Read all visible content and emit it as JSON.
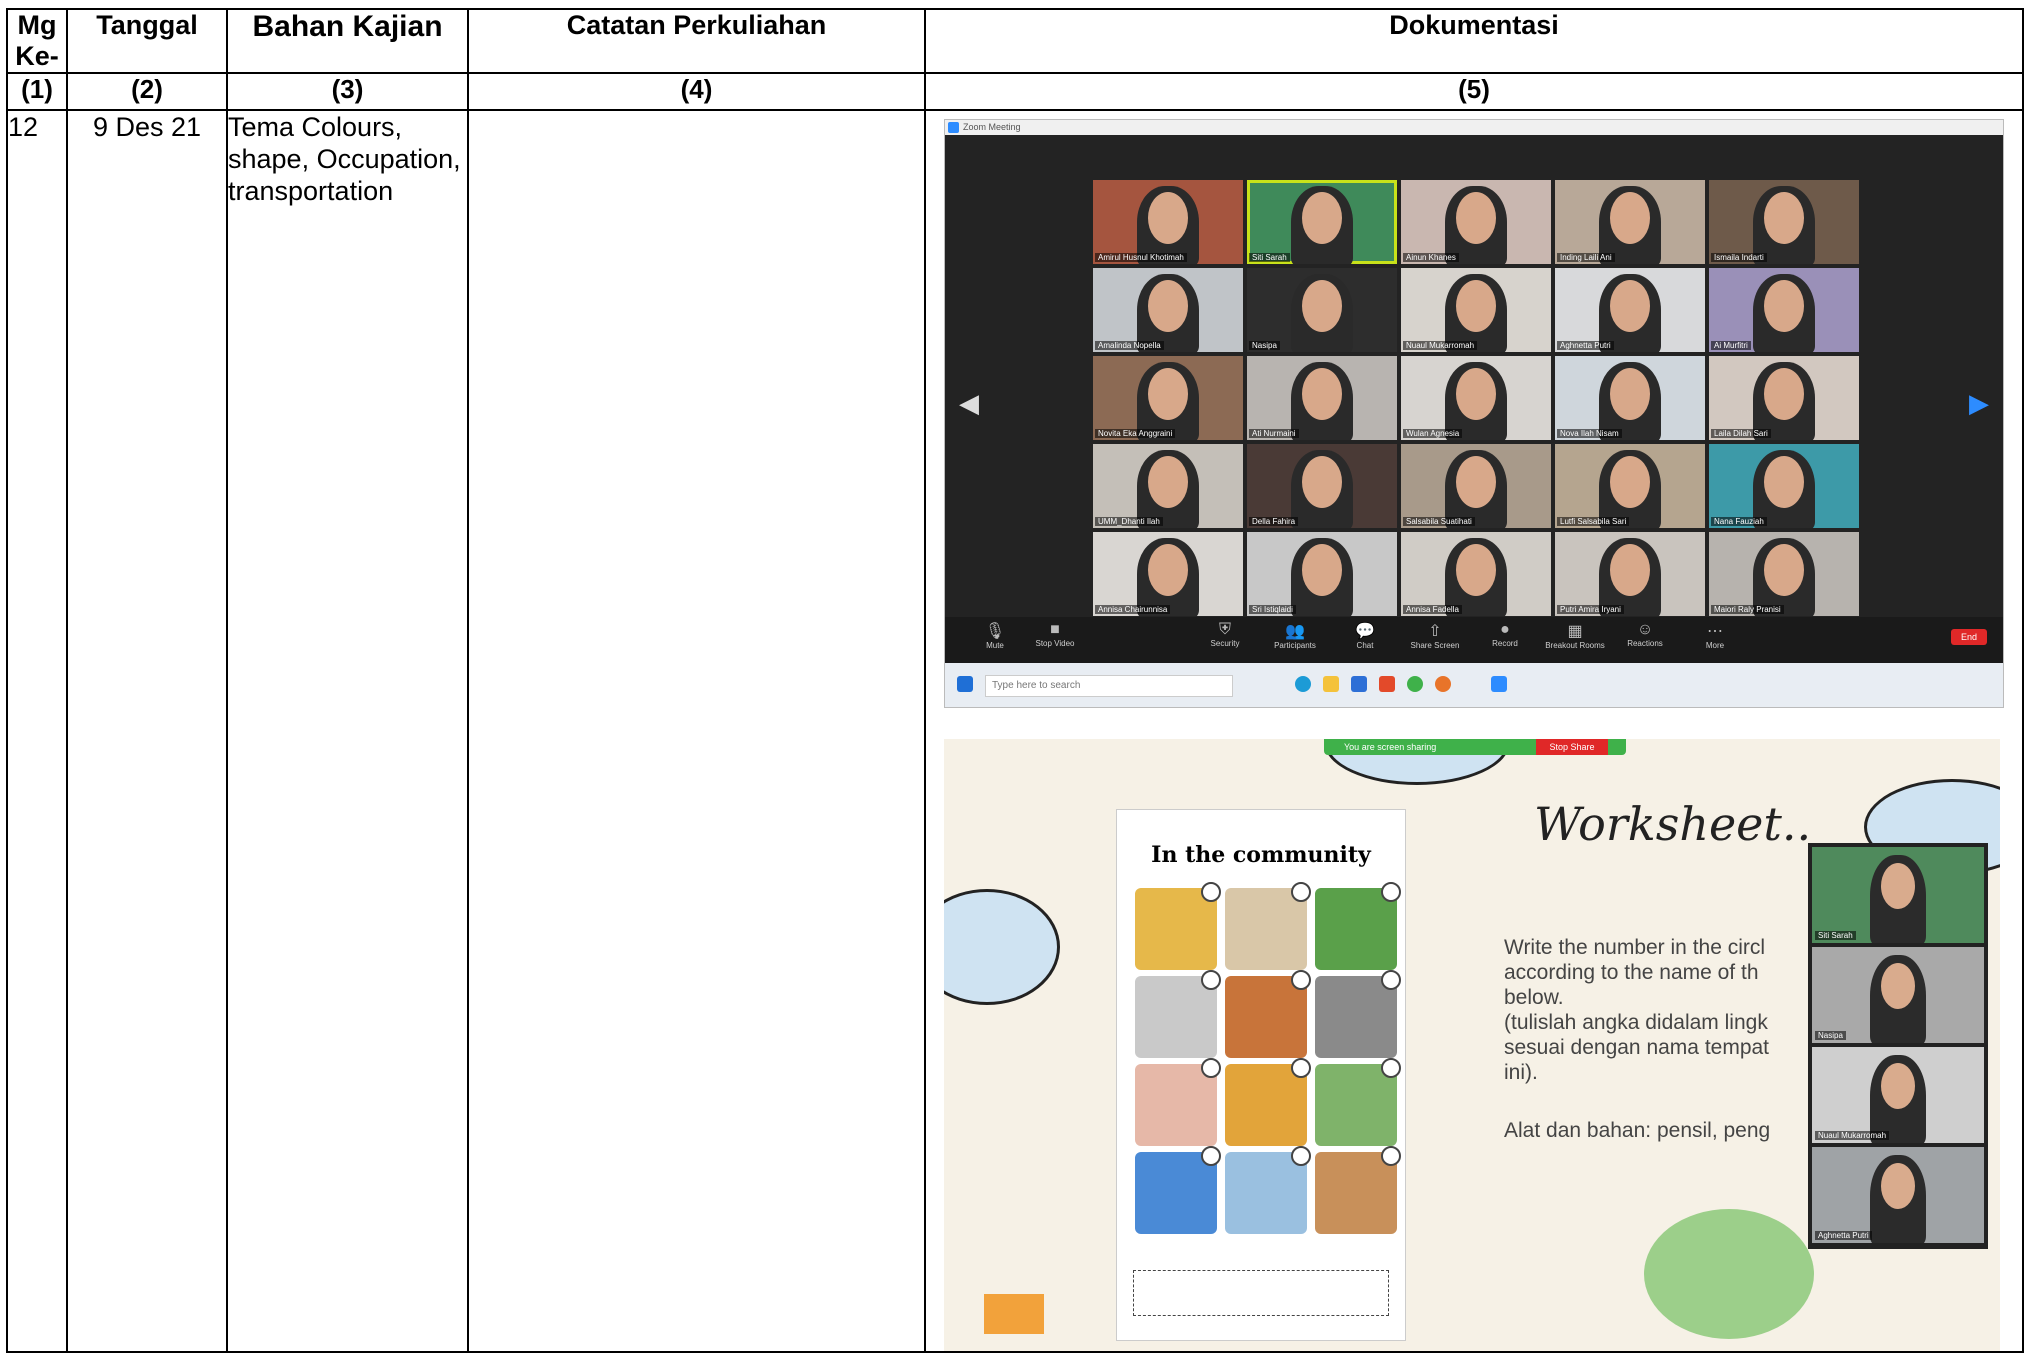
{
  "headers": {
    "mg": "Mg Ke-",
    "tanggal": "Tanggal",
    "bahan": "Bahan Kajian",
    "catatan": "Catatan Perkuliahan",
    "dokumentasi": "Dokumentasi"
  },
  "numbers": [
    "(1)",
    "(2)",
    "(3)",
    "(4)",
    "(5)"
  ],
  "row": {
    "mg": "12",
    "tanggal": "9 Des 21",
    "bahan": "Tema Colours, shape, Occupation, transportation",
    "catatan": ""
  },
  "zoom": {
    "window_title": "Zoom Meeting",
    "participants": [
      "Amirul Husnul Khotimah",
      "Siti Sarah",
      "Ainun Khanes",
      "Inding Laili Ani",
      "Ismaila Indarti",
      "Amalinda Nopella",
      "Nasipa",
      "Nuaul Mukarromah",
      "Aghnetta Putri",
      "Ai Murfitri",
      "Novita Eka Anggraini",
      "Ati Nurmaini",
      "Wulan Agnesia",
      "Nova Ilah Nisam",
      "Laila Dilah Sari",
      "UMM_Dhanti Ilah",
      "Della Fahira",
      "Salsabila Suatihati",
      "Lutfi Salsabila Sari",
      "Nana Fauziah",
      "Annisa Chairunnisa",
      "Sri Istiqlaidi",
      "Annisa Fadella",
      "Putri Amira Iryani",
      "Maiori Raly Pranisi"
    ],
    "toolbar": [
      "Mute",
      "Stop Video",
      "Security",
      "Participants",
      "Chat",
      "Share Screen",
      "Record",
      "Breakout Rooms",
      "Reactions",
      "More"
    ],
    "end_label": "End",
    "search_placeholder": "Type here to search"
  },
  "slide": {
    "share_notice": "You are screen sharing",
    "stop_share": "Stop Share",
    "sheet_title": "In the community",
    "worksheet_title": "Worksheet..",
    "instructions": "Write the number in the circl\naccording to the name of th\nbelow.\n(tulislah angka didalam lingk\nsesuai dengan nama tempat\nini).",
    "tools": "Alat dan bahan: pensil, peng",
    "gallery": [
      "Siti Sarah",
      "Nasipa",
      "Nuaul Mukarromah",
      "Aghnetta Putri"
    ]
  },
  "colors": {
    "zoom_bg": "#232323",
    "zoom_blue": "#2d8cff",
    "share_green": "#3fb14a",
    "end_red": "#e02828",
    "slide_bg": "#f6f1e6"
  }
}
